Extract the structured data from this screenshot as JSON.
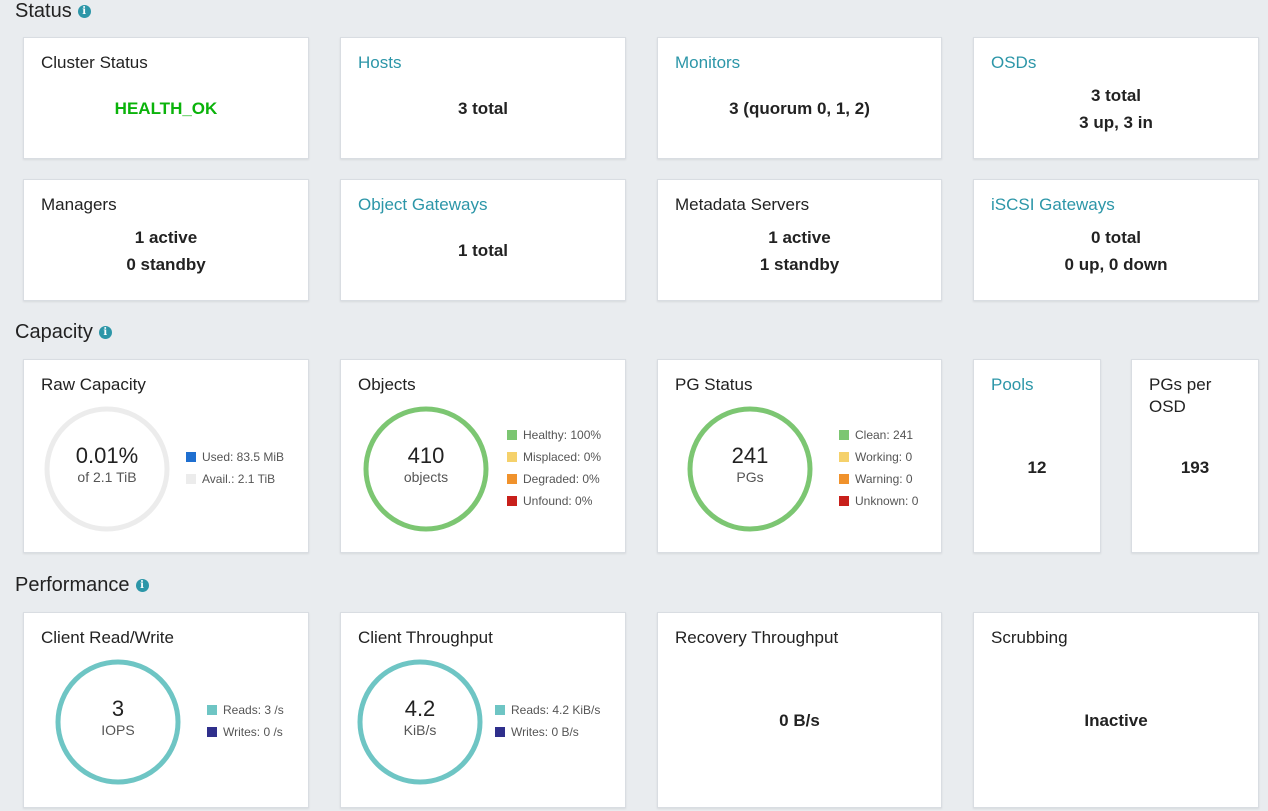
{
  "sections": {
    "status": "Status",
    "capacity": "Capacity",
    "performance": "Performance",
    "info_icon_glyph": "i"
  },
  "status": {
    "cluster_status": {
      "title": "Cluster Status",
      "value": "HEALTH_OK"
    },
    "hosts": {
      "title": "Hosts",
      "value": "3 total"
    },
    "monitors": {
      "title": "Monitors",
      "value": "3 (quorum 0, 1, 2)"
    },
    "osds": {
      "title": "OSDs",
      "line1": "3 total",
      "line2": "3 up, 3 in"
    },
    "managers": {
      "title": "Managers",
      "line1": "1 active",
      "line2": "0 standby"
    },
    "object_gateways": {
      "title": "Object Gateways",
      "value": "1 total"
    },
    "metadata_servers": {
      "title": "Metadata Servers",
      "line1": "1 active",
      "line2": "1 standby"
    },
    "iscsi_gateways": {
      "title": "iSCSI Gateways",
      "line1": "0 total",
      "line2": "0 up, 0 down"
    }
  },
  "capacity": {
    "raw_capacity": {
      "title": "Raw Capacity",
      "big": "0.01%",
      "small": "of 2.1 TiB",
      "used_fraction": 0.0001,
      "legend": [
        {
          "label": "Used: 83.5 MiB",
          "color": "#1f6fd0"
        },
        {
          "label": "Avail.: 2.1 TiB",
          "color": "#ececec"
        }
      ]
    },
    "objects": {
      "title": "Objects",
      "big": "410",
      "small": "objects",
      "legend": [
        {
          "label": "Healthy: 100%",
          "color": "#7cc672"
        },
        {
          "label": "Misplaced: 0%",
          "color": "#f5d16b"
        },
        {
          "label": "Degraded: 0%",
          "color": "#f0922c"
        },
        {
          "label": "Unfound: 0%",
          "color": "#c8201b"
        }
      ]
    },
    "pg_status": {
      "title": "PG Status",
      "big": "241",
      "small": "PGs",
      "legend": [
        {
          "label": "Clean: 241",
          "color": "#7cc672"
        },
        {
          "label": "Working: 0",
          "color": "#f5d16b"
        },
        {
          "label": "Warning: 0",
          "color": "#f0922c"
        },
        {
          "label": "Unknown: 0",
          "color": "#c8201b"
        }
      ]
    },
    "pools": {
      "title": "Pools",
      "value": "12"
    },
    "pgs_per_osd": {
      "title_line1": "PGs per",
      "title_line2": "OSD",
      "value": "193"
    }
  },
  "performance": {
    "client_rw": {
      "title": "Client Read/Write",
      "big": "3",
      "small": "IOPS",
      "legend": [
        {
          "label": "Reads: 3 /s",
          "color": "#6ec5c4"
        },
        {
          "label": "Writes: 0 /s",
          "color": "#2f2f8c"
        }
      ]
    },
    "client_throughput": {
      "title": "Client Throughput",
      "big": "4.2",
      "small": "KiB/s",
      "legend": [
        {
          "label": "Reads: 4.2 KiB/s",
          "color": "#6ec5c4"
        },
        {
          "label": "Writes: 0 B/s",
          "color": "#2f2f8c"
        }
      ]
    },
    "recovery_throughput": {
      "title": "Recovery Throughput",
      "value": "0 B/s"
    },
    "scrubbing": {
      "title": "Scrubbing",
      "value": "Inactive"
    }
  },
  "colors": {
    "link": "#2c96a8",
    "health_ok": "#0bb30b",
    "ring_green": "#7cc672",
    "ring_teal": "#6ec5c4",
    "ring_gray": "#ececec"
  }
}
